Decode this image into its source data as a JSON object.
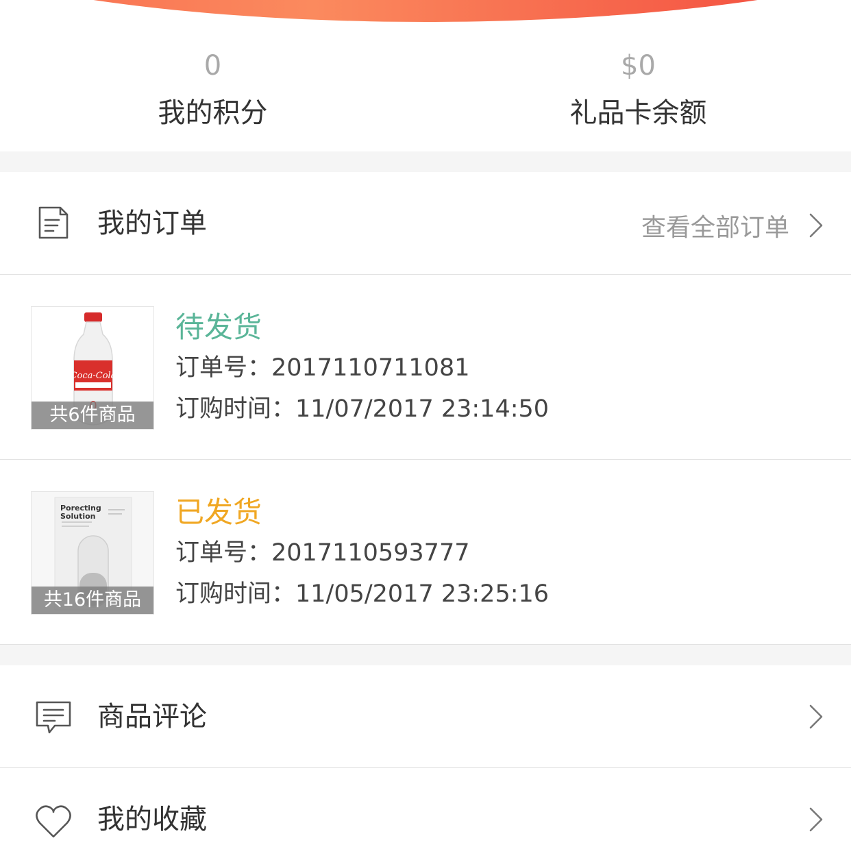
{
  "stats": {
    "points": {
      "value": "0",
      "label": "我的积分"
    },
    "gift_card": {
      "value": "$0",
      "label": "礼品卡余额"
    }
  },
  "orders_header": {
    "title": "我的订单",
    "view_all": "查看全部订单"
  },
  "orders": [
    {
      "status": "待发货",
      "status_color": "#5ab598",
      "order_no": "订单号：2017110711081",
      "order_time": "订购时间：11/07/2017 23:14:50",
      "item_count": "共6件商品",
      "thumb": "cola-bottle"
    },
    {
      "status": "已发货",
      "status_color": "#f0a723",
      "order_no": "订单号：2017110593777",
      "order_time": "订购时间：11/05/2017 23:25:16",
      "item_count": "共16件商品",
      "thumb": "face-mask",
      "thumb_text": "Porecting Solution"
    }
  ],
  "menu": [
    {
      "label": "商品评论",
      "icon": "comment-icon"
    },
    {
      "label": "我的收藏",
      "icon": "heart-icon"
    }
  ],
  "colors": {
    "accent": "#f55b46",
    "text_muted": "#999999"
  }
}
